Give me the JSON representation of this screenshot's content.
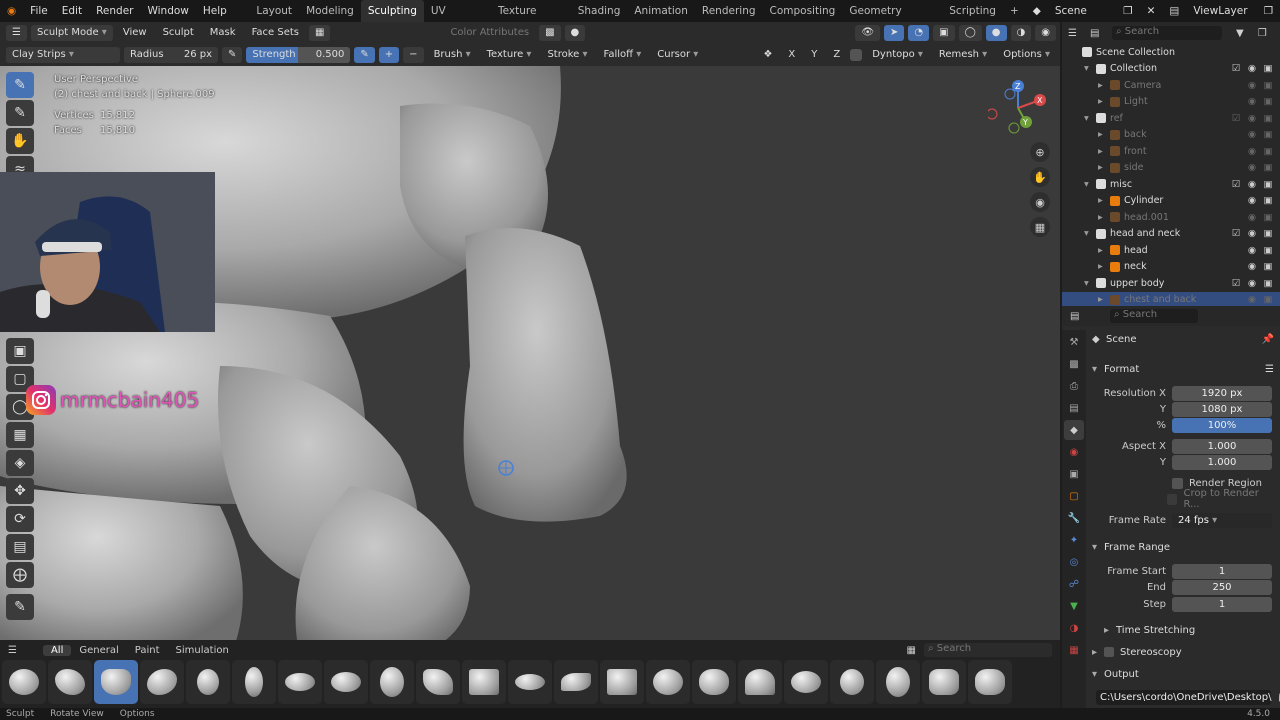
{
  "menu": {
    "file": "File",
    "edit": "Edit",
    "render": "Render",
    "window": "Window",
    "help": "Help"
  },
  "workspaces": [
    "Layout",
    "Modeling",
    "Sculpting",
    "UV Editing",
    "Texture Paint",
    "Shading",
    "Animation",
    "Rendering",
    "Compositing",
    "Geometry Nodes",
    "Scripting"
  ],
  "scene_label": "Scene",
  "viewlayer_label": "ViewLayer",
  "vp_header": {
    "mode": "Sculpt Mode",
    "view": "View",
    "sculpt": "Sculpt",
    "mask": "Mask",
    "face_sets": "Face Sets",
    "color_attr": "Color Attributes"
  },
  "tool_header": {
    "brush_name": "Clay Strips",
    "radius_label": "Radius",
    "radius_value": "26 px",
    "strength_label": "Strength",
    "strength_value": "0.500",
    "brush": "Brush",
    "texture": "Texture",
    "stroke": "Stroke",
    "falloff": "Falloff",
    "cursor": "Cursor",
    "x": "X",
    "y": "Y",
    "z": "Z",
    "dyntopo": "Dyntopo",
    "remesh": "Remesh",
    "options": "Options"
  },
  "overlay": {
    "perspective": "User Perspective",
    "object": "(2) chest and back | Sphere.009",
    "vertices_label": "Vertices",
    "vertices_value": "15,812",
    "faces_label": "Faces",
    "faces_value": "15,810"
  },
  "instagram_handle": "mrmcbain405",
  "shelf": {
    "tabs": [
      "All",
      "General",
      "Paint",
      "Simulation"
    ],
    "search_placeholder": "Search"
  },
  "status": {
    "sculpt": "Sculpt",
    "rotate": "Rotate View",
    "options": "Options",
    "version": "4.5.0"
  },
  "outliner": {
    "search_placeholder": "Search",
    "rows": [
      {
        "name": "Scene Collection",
        "indent": 0,
        "dim": false
      },
      {
        "name": "Collection",
        "indent": 1,
        "dim": false
      },
      {
        "name": "Camera",
        "indent": 2,
        "dim": true
      },
      {
        "name": "Light",
        "indent": 2,
        "dim": true
      },
      {
        "name": "ref",
        "indent": 1,
        "dim": true
      },
      {
        "name": "back",
        "indent": 2,
        "dim": true
      },
      {
        "name": "front",
        "indent": 2,
        "dim": true
      },
      {
        "name": "side",
        "indent": 2,
        "dim": true
      },
      {
        "name": "misc",
        "indent": 1,
        "dim": false
      },
      {
        "name": "Cylinder",
        "indent": 2,
        "dim": false
      },
      {
        "name": "head.001",
        "indent": 2,
        "dim": true
      },
      {
        "name": "head and neck",
        "indent": 1,
        "dim": false
      },
      {
        "name": "head",
        "indent": 2,
        "dim": false
      },
      {
        "name": "neck",
        "indent": 2,
        "dim": false
      },
      {
        "name": "upper body",
        "indent": 1,
        "dim": false
      },
      {
        "name": "chest and back",
        "indent": 2,
        "dim": true,
        "sel": true
      }
    ]
  },
  "props": {
    "search_placeholder": "Search",
    "scene": "Scene",
    "format": "Format",
    "res_x_label": "Resolution X",
    "res_x": "1920 px",
    "res_y_label": "Y",
    "res_y": "1080 px",
    "pct_label": "%",
    "pct": "100%",
    "aspect_x_label": "Aspect X",
    "aspect_x": "1.000",
    "aspect_y_label": "Y",
    "aspect_y": "1.000",
    "render_region": "Render Region",
    "crop": "Crop to Render R...",
    "frame_rate_label": "Frame Rate",
    "frame_rate": "24 fps",
    "frame_range": "Frame Range",
    "start_label": "Frame Start",
    "start": "1",
    "end_label": "End",
    "end": "250",
    "step_label": "Step",
    "step": "1",
    "time_stretching": "Time Stretching",
    "stereoscopy": "Stereoscopy",
    "output": "Output",
    "output_path": "C:\\Users\\cordo\\OneDrive\\Desktop\\"
  }
}
